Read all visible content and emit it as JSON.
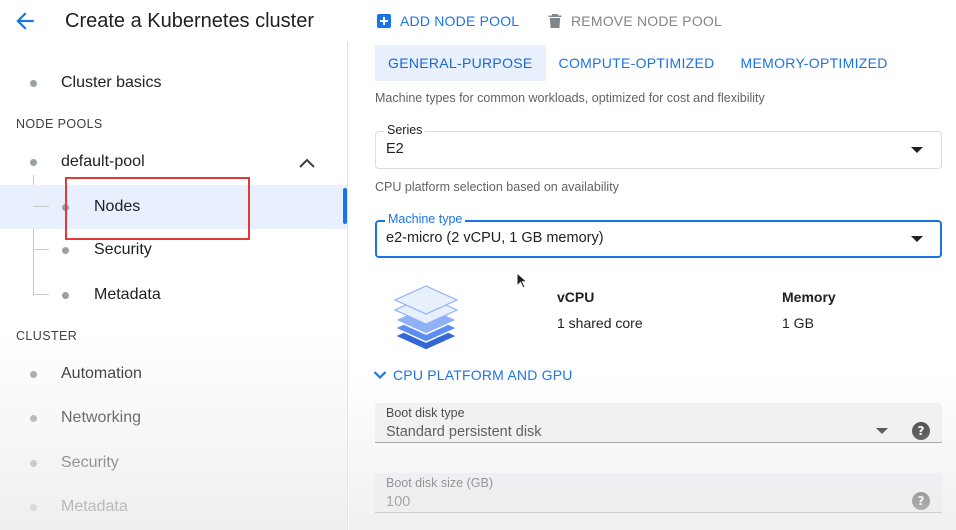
{
  "header": {
    "title": "Create a Kubernetes cluster",
    "add_node_pool": "ADD NODE POOL",
    "remove_node_pool": "REMOVE NODE POOL"
  },
  "nav": {
    "cluster_basics": "Cluster basics",
    "node_pools_heading": "NODE POOLS",
    "default_pool": "default-pool",
    "pool_items": [
      "Nodes",
      "Security",
      "Metadata"
    ],
    "cluster_heading": "CLUSTER",
    "cluster_items": [
      "Automation",
      "Networking",
      "Security",
      "Metadata"
    ]
  },
  "tabs": [
    "GENERAL-PURPOSE",
    "COMPUTE-OPTIMIZED",
    "MEMORY-OPTIMIZED"
  ],
  "form": {
    "tab_description": "Machine types for common workloads, optimized for cost and flexibility",
    "series": {
      "label": "Series",
      "value": "E2"
    },
    "series_helper": "CPU platform selection based on availability",
    "machine_type": {
      "label": "Machine type",
      "value": "e2-micro (2 vCPU, 1 GB memory)"
    },
    "specs": {
      "vcpu_label": "vCPU",
      "vcpu_value": "1 shared core",
      "memory_label": "Memory",
      "memory_value": "1 GB"
    },
    "cpu_platform_toggle": "CPU PLATFORM AND GPU",
    "boot_disk_type": {
      "label": "Boot disk type",
      "value": "Standard persistent disk"
    },
    "boot_disk_size": {
      "label": "Boot disk size (GB)",
      "value": "100"
    }
  },
  "colors": {
    "accent": "#1a73e8",
    "selected_bg": "#e8f0fe",
    "highlight_box": "#e53935"
  }
}
